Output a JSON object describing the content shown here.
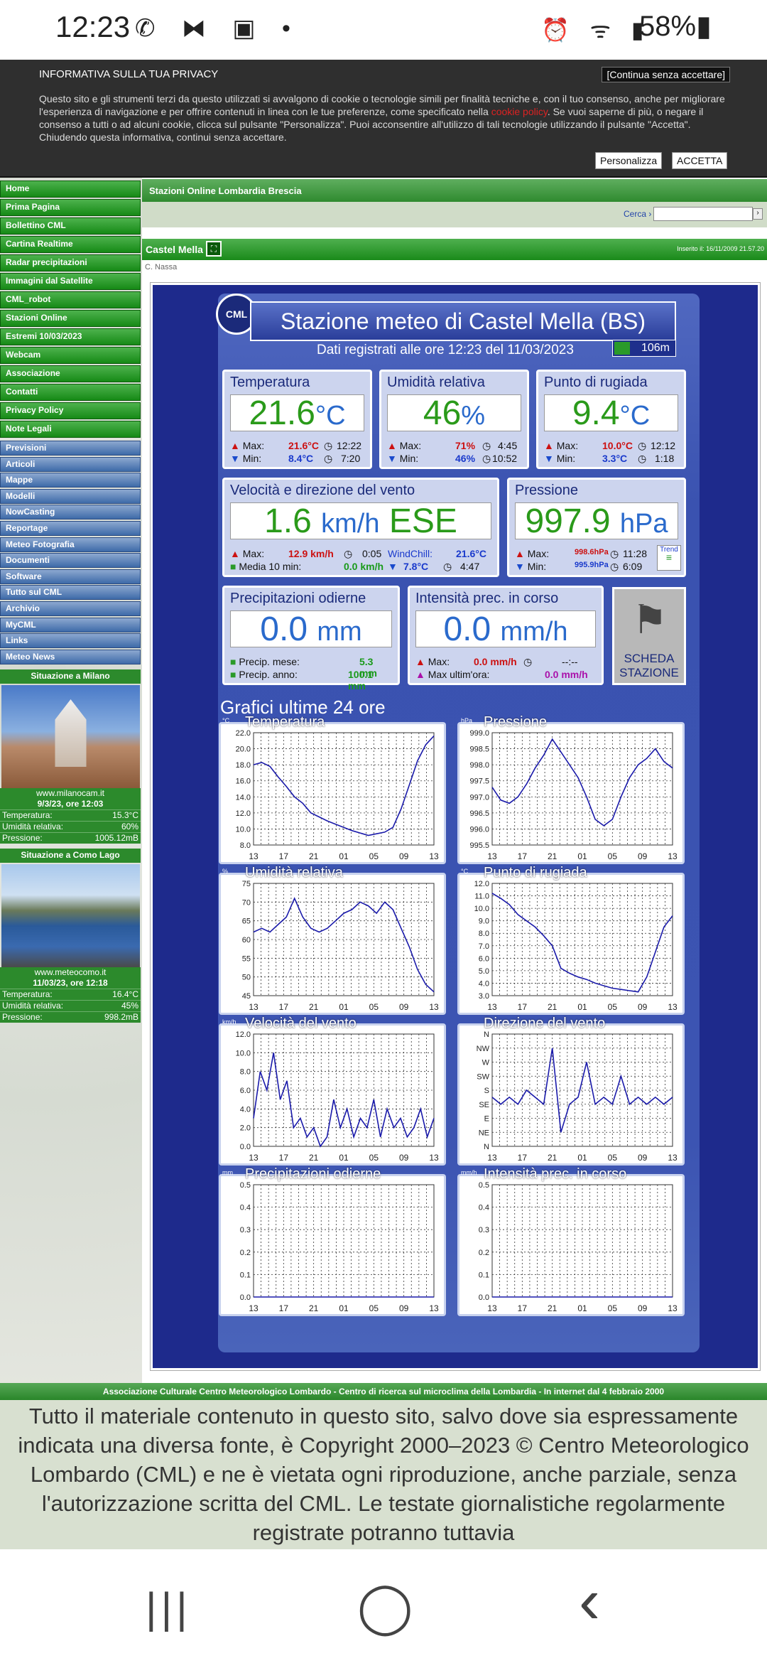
{
  "status_bar": {
    "time": "12:23",
    "left_icons": "✆ ⧓ ▣ •",
    "right_icons": "⏰ ᯤ ▮",
    "battery": "58%▮"
  },
  "privacy": {
    "title": "INFORMATIVA SULLA TUA PRIVACY",
    "continue": "[Continua senza accettare]",
    "text_a": "Questo sito e gli strumenti terzi da questo utilizzati si avvalgono di cookie o tecnologie simili per finalità tecniche e, con il tuo consenso, anche per migliorare l'esperienza di navigazione e per offrire contenuti in linea con le tue preferenze, come specificato nella ",
    "link": "cookie policy",
    "text_b": ". Se vuoi saperne di più, o negare il consenso a tutti o ad alcuni cookie, clicca sul pulsante \"Personalizza\". Puoi acconsentire all'utilizzo di tali tecnologie utilizzando il pulsante \"Accetta\". Chiudendo questa informativa, continui senza accettare.",
    "btn_customize": "Personalizza",
    "btn_accept": "ACCETTA"
  },
  "nav_green": [
    "Home",
    "Prima Pagina",
    "Bollettino CML",
    "Cartina Realtime",
    "Radar precipitazioni",
    "Immagini dal Satellite",
    "CML_robot",
    "Stazioni Online",
    "Estremi 10/03/2023",
    "Webcam",
    "Associazione",
    "Contatti",
    "Privacy Policy",
    "Note Legali"
  ],
  "nav_blue": [
    "Previsioni",
    "Articoli",
    "Mappe",
    "Modelli",
    "NowCasting",
    "Reportage",
    "Meteo Fotografia",
    "Documenti",
    "Software",
    "Tutto sul CML",
    "Archivio",
    "MyCML",
    "Links",
    "Meteo News"
  ],
  "side": {
    "milano": {
      "head": "Situazione a Milano",
      "site": "www.milanocam.it",
      "date": "9/3/23, ore 12:03",
      "temp_l": "Temperatura:",
      "temp": "15.3°C",
      "hum_l": "Umidità relativa:",
      "hum": "60%",
      "pres_l": "Pressione:",
      "pres": "1005.12mB"
    },
    "como": {
      "head": "Situazione a Como Lago",
      "site": "www.meteocomo.it",
      "date": "11/03/23, ore 12:18",
      "temp_l": "Temperatura:",
      "temp": "16.4°C",
      "hum_l": "Umidità relativa:",
      "hum": "45%",
      "pres_l": "Pressione:",
      "pres": "998.2mB"
    }
  },
  "breadcrumb": "Stazioni Online  Lombardia  Brescia",
  "search": {
    "label": "Cerca ›",
    "go": "›"
  },
  "titlebar": {
    "name": "Castel Mella",
    "inserted": "Inserito il: 16/11/2009 21.57.20"
  },
  "author": "C. Nassa",
  "station": {
    "logo": "CML",
    "title": "Stazione meteo di Castel Mella (BS)",
    "subtitle": "Dati registrati alle ore 12:23 del 11/03/2023",
    "altitude": "106m",
    "temp": {
      "label": "Temperatura",
      "value": "21.6",
      "unit": "°C",
      "max_l": "Max:",
      "max": "21.6°C",
      "max_t": "12:22",
      "min_l": "Min:",
      "min": "8.4°C",
      "min_t": "7:20"
    },
    "hum": {
      "label": "Umidità relativa",
      "value": "46",
      "unit": "%",
      "max_l": "Max:",
      "max": "71%",
      "max_t": "4:45",
      "min_l": "Min:",
      "min": "46%",
      "min_t": "10:52"
    },
    "dew": {
      "label": "Punto di rugiada",
      "value": "9.4",
      "unit": "°C",
      "max_l": "Max:",
      "max": "10.0°C",
      "max_t": "12:12",
      "min_l": "Min:",
      "min": "3.3°C",
      "min_t": "1:18"
    },
    "wind": {
      "label": "Velocità e direzione del vento",
      "value": "1.6",
      "unit": "km/h",
      "dir": "ESE",
      "max_l": "Max:",
      "max": "12.9 km/h",
      "max_t": "0:05",
      "avg_l": "Media 10 min:",
      "avg": "0.0 km/h",
      "wc_l": "WindChill:",
      "wc": "21.6°C",
      "wc_min": "7.8°C",
      "wc_t": "4:47"
    },
    "pres": {
      "label": "Pressione",
      "value": "997.9",
      "unit": "hPa",
      "max_l": "Max:",
      "max": "998.6hPa",
      "max_t": "11:28",
      "min_l": "Min:",
      "min": "995.9hPa",
      "min_t": "6:09",
      "trend": "Trend"
    },
    "rain": {
      "label": "Precipitazioni odierne",
      "value": "0.0",
      "unit": "mm",
      "month_l": "Precip. mese:",
      "month": "5.3 mm",
      "year_l": "Precip. anno:",
      "year": "100.1 mm"
    },
    "rate": {
      "label": "Intensità prec. in corso",
      "value": "0.0",
      "unit": "mm/h",
      "max_l": "Max:",
      "max": "0.0 mm/h",
      "max_t": "--:--",
      "hour_l": "Max ultim'ora:",
      "hour": "0.0 mm/h"
    },
    "scheda": [
      "SCHEDA",
      "STAZIONE"
    ],
    "graphs_title": "Grafici ultime 24 ore"
  },
  "x_ticks": [
    "13",
    "17",
    "21",
    "01",
    "05",
    "09",
    "13"
  ],
  "chart_data": [
    {
      "type": "line",
      "title": "Temperatura",
      "unit": "°C",
      "ylim": [
        8,
        22
      ],
      "yticks": [
        "22.0",
        "20.0",
        "18.0",
        "16.0",
        "14.0",
        "12.0",
        "10.0",
        "8.0"
      ],
      "x": [
        "13",
        "17",
        "21",
        "01",
        "05",
        "09",
        "13"
      ],
      "values": [
        18.0,
        18.3,
        17.8,
        16.5,
        15.3,
        14.0,
        13.2,
        12.0,
        11.5,
        11.0,
        10.6,
        10.2,
        9.8,
        9.5,
        9.2,
        9.4,
        9.6,
        10.2,
        12.5,
        15.5,
        18.5,
        20.5,
        21.6
      ]
    },
    {
      "type": "line",
      "title": "Pressione",
      "unit": "hPa",
      "ylim": [
        995.5,
        999
      ],
      "yticks": [
        "999.0",
        "998.5",
        "998.0",
        "997.5",
        "997.0",
        "996.5",
        "996.0",
        "995.5"
      ],
      "x": [
        "13",
        "17",
        "21",
        "01",
        "05",
        "09",
        "13"
      ],
      "values": [
        997.3,
        996.9,
        996.8,
        997.0,
        997.4,
        997.9,
        998.3,
        998.8,
        998.4,
        998.0,
        997.6,
        997.0,
        996.3,
        996.1,
        996.3,
        997.0,
        997.6,
        998.0,
        998.2,
        998.5,
        998.1,
        997.9
      ]
    },
    {
      "type": "line",
      "title": "Umidità relativa",
      "unit": "%",
      "ylim": [
        45,
        75
      ],
      "yticks": [
        "75",
        "70",
        "65",
        "60",
        "55",
        "50",
        "45"
      ],
      "x": [
        "13",
        "17",
        "21",
        "01",
        "05",
        "09",
        "13"
      ],
      "values": [
        62,
        63,
        62,
        64,
        66,
        71,
        66,
        63,
        62,
        63,
        65,
        67,
        68,
        70,
        69,
        67,
        70,
        68,
        63,
        58,
        52,
        48,
        46
      ]
    },
    {
      "type": "line",
      "title": "Punto di rugiada",
      "unit": "°C",
      "ylim": [
        3,
        12
      ],
      "yticks": [
        "12.0",
        "11.0",
        "10.0",
        "9.0",
        "8.0",
        "7.0",
        "6.0",
        "5.0",
        "4.0",
        "3.0"
      ],
      "x": [
        "13",
        "17",
        "21",
        "01",
        "05",
        "09",
        "13"
      ],
      "values": [
        11.2,
        10.8,
        10.3,
        9.5,
        9.0,
        8.5,
        7.8,
        7.0,
        5.2,
        4.8,
        4.5,
        4.3,
        4.0,
        3.8,
        3.6,
        3.5,
        3.4,
        3.3,
        4.5,
        6.5,
        8.5,
        9.4
      ]
    },
    {
      "type": "line",
      "title": "Velocità del vento",
      "unit": "km/h",
      "ylim": [
        0,
        12
      ],
      "yticks": [
        "12.0",
        "10.0",
        "8.0",
        "6.0",
        "4.0",
        "2.0",
        "0.0"
      ],
      "x": [
        "13",
        "17",
        "21",
        "01",
        "05",
        "09",
        "13"
      ],
      "values": [
        3,
        8,
        6,
        10,
        5,
        7,
        2,
        3,
        1,
        2,
        0,
        1,
        5,
        2,
        4,
        1,
        3,
        2,
        5,
        1,
        4,
        2,
        3,
        1,
        2,
        4,
        1,
        3
      ]
    },
    {
      "type": "line",
      "title": "Direzione del vento",
      "unit": "",
      "ylim": [
        0,
        8
      ],
      "yticks": [
        "N",
        "NW",
        "W",
        "SW",
        "S",
        "SE",
        "E",
        "NE",
        "N"
      ],
      "x": [
        "13",
        "17",
        "21",
        "01",
        "05",
        "09",
        "13"
      ],
      "values": [
        3.5,
        3,
        3.5,
        3,
        4,
        3.5,
        3,
        7,
        1,
        3,
        3.5,
        6,
        3,
        3.5,
        3,
        5,
        3,
        3.5,
        3,
        3.5,
        3,
        3.5
      ]
    },
    {
      "type": "line",
      "title": "Precipitazioni odierne",
      "unit": "mm",
      "ylim": [
        0,
        0.5
      ],
      "yticks": [
        "0.5",
        "0.4",
        "0.3",
        "0.2",
        "0.1",
        "0.0"
      ],
      "x": [
        "13",
        "17",
        "21",
        "01",
        "05",
        "09",
        "13"
      ],
      "values": [
        0,
        0,
        0,
        0,
        0,
        0,
        0,
        0,
        0,
        0,
        0,
        0,
        0,
        0,
        0,
        0,
        0,
        0,
        0,
        0,
        0,
        0
      ]
    },
    {
      "type": "line",
      "title": "Intensità prec. in corso",
      "unit": "mm/h",
      "ylim": [
        0,
        0.5
      ],
      "yticks": [
        "0.5",
        "0.4",
        "0.3",
        "0.2",
        "0.1",
        "0.0"
      ],
      "x": [
        "13",
        "17",
        "21",
        "01",
        "05",
        "09",
        "13"
      ],
      "values": [
        0,
        0,
        0,
        0,
        0,
        0,
        0,
        0,
        0,
        0,
        0,
        0,
        0,
        0,
        0,
        0,
        0,
        0,
        0,
        0,
        0,
        0
      ]
    }
  ],
  "footer": {
    "bar": "Associazione Culturale Centro Meteorologico Lombardo - Centro di ricerca sul microclima della Lombardia - In internet dal 4 febbraio 2000",
    "copyright": "Tutto il materiale contenuto in questo sito, salvo dove sia espressamente indicata una diversa fonte, è Copyright 2000–2023 © Centro Meteorologico Lombardo (CML) e ne è vietata ogni riproduzione, anche parziale, senza l'autorizzazione scritta del CML. Le testate giornalistiche regolarmente registrate potranno tuttavia"
  },
  "navbar": {
    "recent": "|||",
    "home": "◯",
    "back": "‹"
  }
}
